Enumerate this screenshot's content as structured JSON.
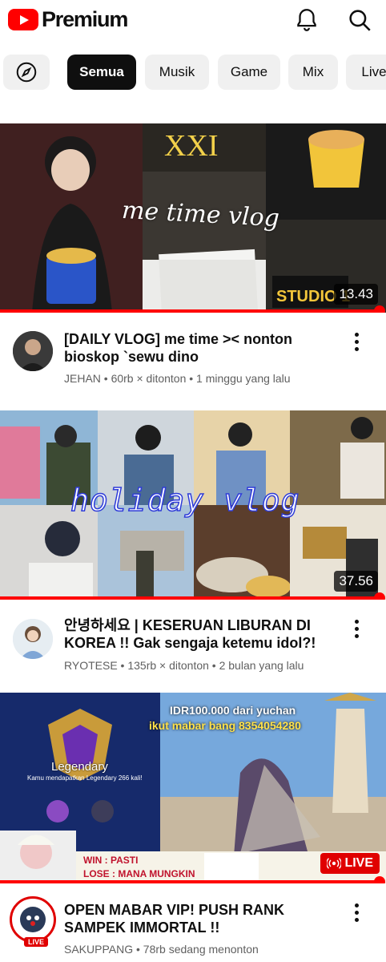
{
  "header": {
    "logo_text": "Premium",
    "icons": [
      "notifications-bell-icon",
      "search-icon"
    ]
  },
  "chips": {
    "explore_icon": "compass-icon",
    "items": [
      "Semua",
      "Musik",
      "Game",
      "Mix",
      "Live"
    ],
    "selected": "Semua"
  },
  "colors": {
    "brand_red": "#ff0000",
    "text_primary": "#0f0f0f",
    "text_secondary": "#606060",
    "chip_bg": "#f0f0f0",
    "live_red": "#e00000"
  },
  "videos": [
    {
      "thumbnail_text": "me time vlog",
      "duration": "13.43",
      "progress_fraction": 0.98,
      "title": "[DAILY VLOG] me time >< nonton bioskop `sewu dino",
      "subtitle": "JEHAN • 60rb × ditonton • 1 minggu yang lalu"
    },
    {
      "thumbnail_text": "holiday vlog",
      "duration": "37.56",
      "progress_fraction": 0.98,
      "title": "안녕하세요 | KESERUAN LIBURAN DI KOREA !! Gak sengaja ketemu idol?!",
      "subtitle": "RYOTESE • 135rb × ditonton • 2 bulan yang lalu"
    },
    {
      "thumbnail_text": {
        "donation_line1": "IDR100.000 dari yuchan",
        "donation_line2": "ikut mabar bang 8354054280",
        "rank": "Legendary",
        "rank_note": "Kamu mendapatkan Legendary 266 kali!",
        "win": "WIN : PASTI",
        "lose": "LOSE : MANA MUNGKIN"
      },
      "live_label": "LIVE",
      "progress_fraction": 0.98,
      "title": "OPEN MABAR VIP! PUSH RANK SAMPEK IMMORTAL !!",
      "subtitle": "SAKUPPANG • 78rb sedang menonton",
      "avatar_live_label": "LIVE"
    }
  ]
}
